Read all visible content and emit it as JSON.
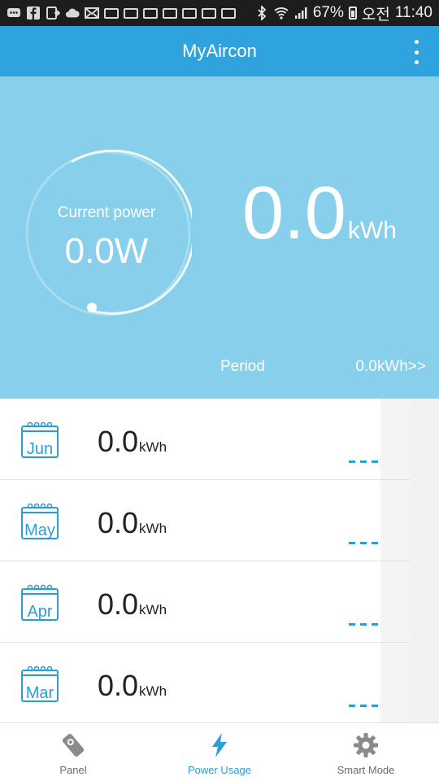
{
  "status_bar": {
    "battery": "67%",
    "ampm": "오전",
    "time": "11:40",
    "icons": [
      "chat-icon",
      "facebook-icon",
      "cast-icon",
      "cloud-icon",
      "mail-icon",
      "sms-icon",
      "sms-icon",
      "photo-icon",
      "gallery-icon",
      "sms-icon",
      "photo-icon",
      "photo-icon",
      "bluetooth-icon",
      "wifi-icon",
      "signal-icon",
      "battery-icon"
    ]
  },
  "app_bar": {
    "title": "MyAircon"
  },
  "current_power": {
    "label": "Current power",
    "value": "0.0W",
    "gauge_level": 0.0
  },
  "total": {
    "value": "0.0",
    "unit": "kWh"
  },
  "period": {
    "label": "Period",
    "link": "0.0kWh>>"
  },
  "months": [
    {
      "month": "Jun",
      "value": "0.0",
      "unit": "kWh",
      "more": "...."
    },
    {
      "month": "May",
      "value": "0.0",
      "unit": "kWh",
      "more": "...."
    },
    {
      "month": "Apr",
      "value": "0.0",
      "unit": "kWh",
      "more": "...."
    },
    {
      "month": "Mar",
      "value": "0.0",
      "unit": "kWh",
      "more": "...."
    }
  ],
  "bottom_nav": [
    {
      "label": "Panel",
      "icon": "remote-icon",
      "active": false
    },
    {
      "label": "Power Usage",
      "icon": "lightning-icon",
      "active": true
    },
    {
      "label": "Smart Mode",
      "icon": "gear-icon",
      "active": false
    }
  ],
  "colors": {
    "primary": "#2fa3dd",
    "hero": "#87cfea",
    "accent": "#2c9ed6"
  }
}
